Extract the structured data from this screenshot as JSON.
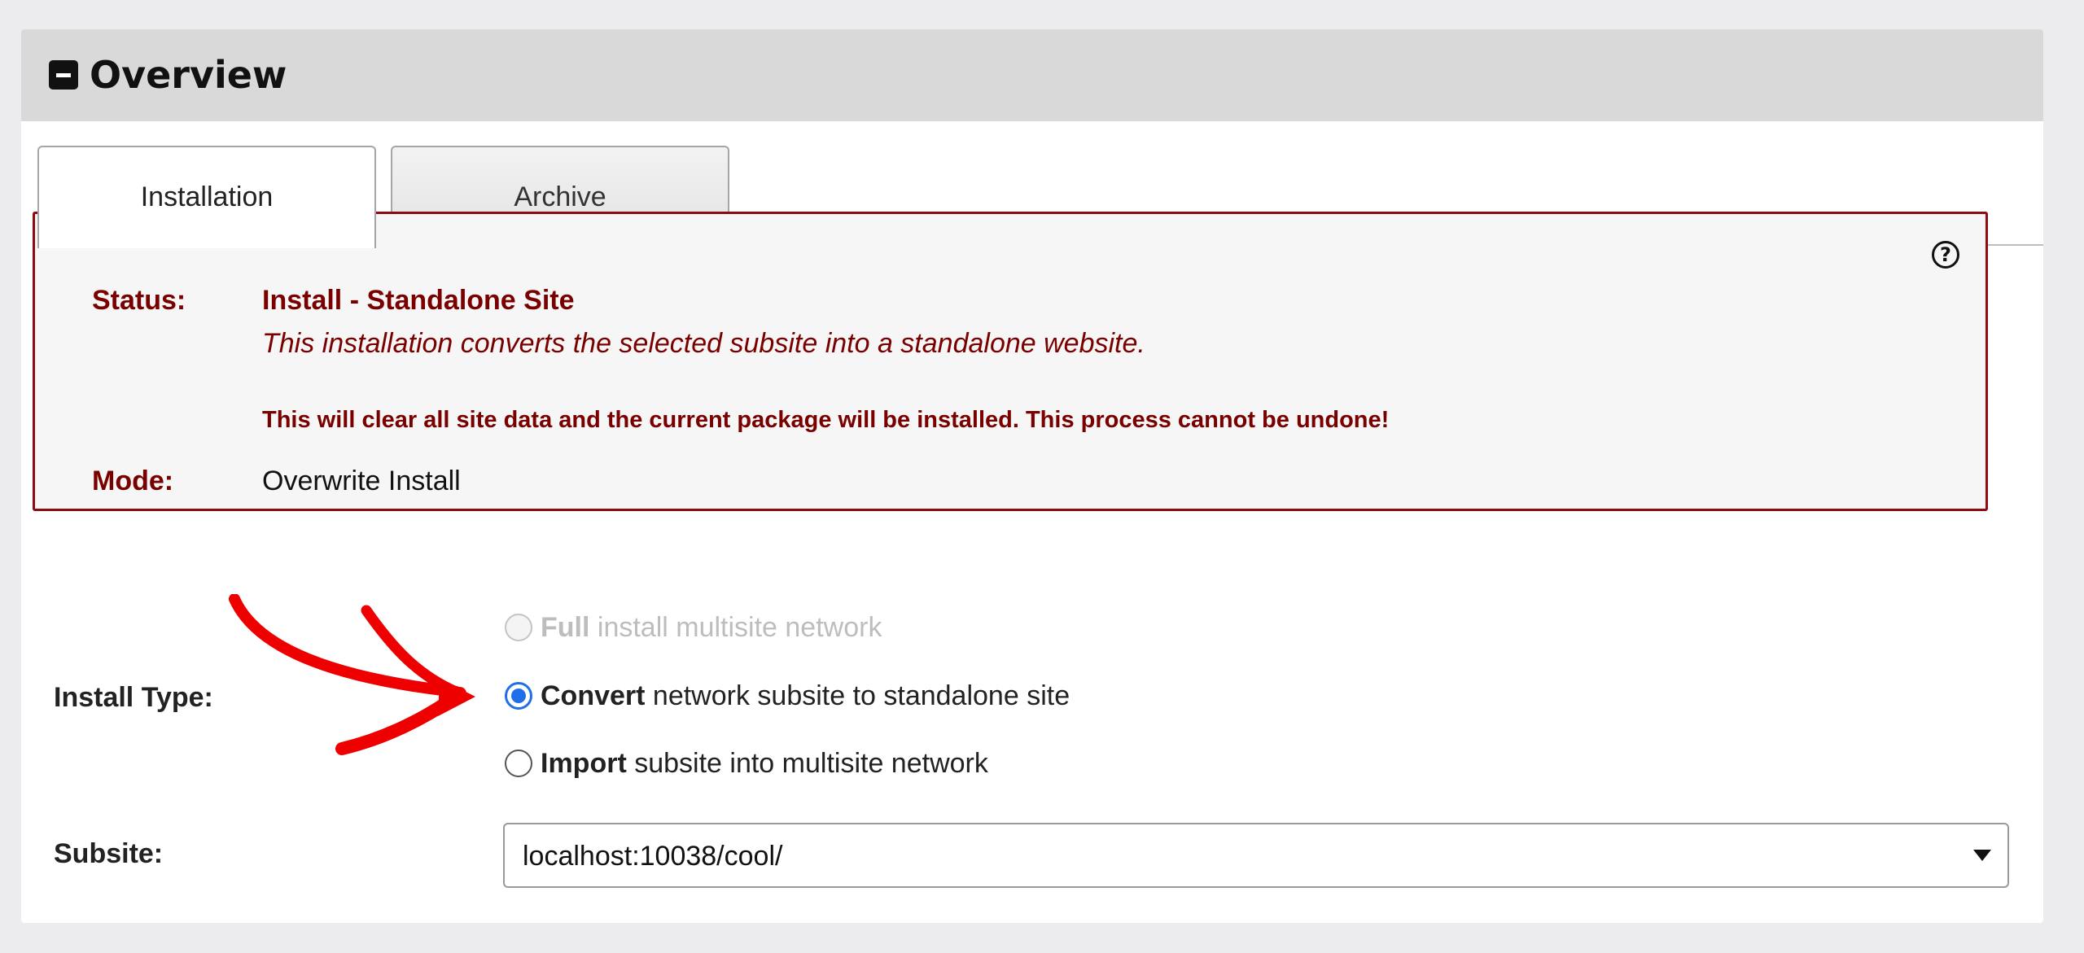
{
  "panel": {
    "title": "Overview"
  },
  "tabs": [
    {
      "label": "Installation",
      "active": true
    },
    {
      "label": "Archive",
      "active": false
    }
  ],
  "status_box": {
    "status_label": "Status:",
    "status_value": "Install - Standalone Site",
    "description": "This installation converts the selected subsite into a standalone website.",
    "warning": "This will clear all site data and the current package will be installed. This process cannot be undone!",
    "mode_label": "Mode:",
    "mode_value": "Overwrite Install",
    "help_icon_glyph": "?"
  },
  "install_type": {
    "label": "Install Type:",
    "options": [
      {
        "bold": "Full",
        "rest": " install multisite network",
        "state": "disabled"
      },
      {
        "bold": "Convert",
        "rest": " network subsite to standalone site",
        "state": "checked"
      },
      {
        "bold": "Import",
        "rest": " subsite into multisite network",
        "state": "unchecked"
      }
    ]
  },
  "subsite": {
    "label": "Subsite:",
    "selected": "localhost:10038/cool/"
  },
  "colors": {
    "accent_dark_red": "#7a0000",
    "border_red": "#8b0d12",
    "radio_blue": "#1f6fe8",
    "annotation_arrow": "#ee0000"
  },
  "icons": [
    "collapse-icon",
    "help-icon",
    "caret-icon",
    "annotation-arrow"
  ]
}
